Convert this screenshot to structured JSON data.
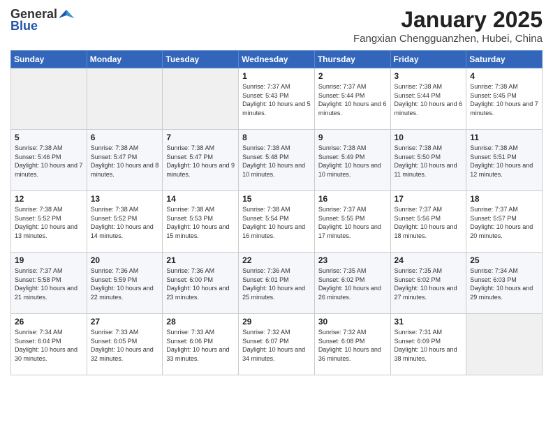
{
  "header": {
    "logo_general": "General",
    "logo_blue": "Blue",
    "title": "January 2025",
    "subtitle": "Fangxian Chengguanzhen, Hubei, China"
  },
  "weekdays": [
    "Sunday",
    "Monday",
    "Tuesday",
    "Wednesday",
    "Thursday",
    "Friday",
    "Saturday"
  ],
  "weeks": [
    [
      {
        "day": "",
        "sunrise": "",
        "sunset": "",
        "daylight": ""
      },
      {
        "day": "",
        "sunrise": "",
        "sunset": "",
        "daylight": ""
      },
      {
        "day": "",
        "sunrise": "",
        "sunset": "",
        "daylight": ""
      },
      {
        "day": "1",
        "sunrise": "Sunrise: 7:37 AM",
        "sunset": "Sunset: 5:43 PM",
        "daylight": "Daylight: 10 hours and 5 minutes."
      },
      {
        "day": "2",
        "sunrise": "Sunrise: 7:37 AM",
        "sunset": "Sunset: 5:44 PM",
        "daylight": "Daylight: 10 hours and 6 minutes."
      },
      {
        "day": "3",
        "sunrise": "Sunrise: 7:38 AM",
        "sunset": "Sunset: 5:44 PM",
        "daylight": "Daylight: 10 hours and 6 minutes."
      },
      {
        "day": "4",
        "sunrise": "Sunrise: 7:38 AM",
        "sunset": "Sunset: 5:45 PM",
        "daylight": "Daylight: 10 hours and 7 minutes."
      }
    ],
    [
      {
        "day": "5",
        "sunrise": "Sunrise: 7:38 AM",
        "sunset": "Sunset: 5:46 PM",
        "daylight": "Daylight: 10 hours and 7 minutes."
      },
      {
        "day": "6",
        "sunrise": "Sunrise: 7:38 AM",
        "sunset": "Sunset: 5:47 PM",
        "daylight": "Daylight: 10 hours and 8 minutes."
      },
      {
        "day": "7",
        "sunrise": "Sunrise: 7:38 AM",
        "sunset": "Sunset: 5:47 PM",
        "daylight": "Daylight: 10 hours and 9 minutes."
      },
      {
        "day": "8",
        "sunrise": "Sunrise: 7:38 AM",
        "sunset": "Sunset: 5:48 PM",
        "daylight": "Daylight: 10 hours and 10 minutes."
      },
      {
        "day": "9",
        "sunrise": "Sunrise: 7:38 AM",
        "sunset": "Sunset: 5:49 PM",
        "daylight": "Daylight: 10 hours and 10 minutes."
      },
      {
        "day": "10",
        "sunrise": "Sunrise: 7:38 AM",
        "sunset": "Sunset: 5:50 PM",
        "daylight": "Daylight: 10 hours and 11 minutes."
      },
      {
        "day": "11",
        "sunrise": "Sunrise: 7:38 AM",
        "sunset": "Sunset: 5:51 PM",
        "daylight": "Daylight: 10 hours and 12 minutes."
      }
    ],
    [
      {
        "day": "12",
        "sunrise": "Sunrise: 7:38 AM",
        "sunset": "Sunset: 5:52 PM",
        "daylight": "Daylight: 10 hours and 13 minutes."
      },
      {
        "day": "13",
        "sunrise": "Sunrise: 7:38 AM",
        "sunset": "Sunset: 5:52 PM",
        "daylight": "Daylight: 10 hours and 14 minutes."
      },
      {
        "day": "14",
        "sunrise": "Sunrise: 7:38 AM",
        "sunset": "Sunset: 5:53 PM",
        "daylight": "Daylight: 10 hours and 15 minutes."
      },
      {
        "day": "15",
        "sunrise": "Sunrise: 7:38 AM",
        "sunset": "Sunset: 5:54 PM",
        "daylight": "Daylight: 10 hours and 16 minutes."
      },
      {
        "day": "16",
        "sunrise": "Sunrise: 7:37 AM",
        "sunset": "Sunset: 5:55 PM",
        "daylight": "Daylight: 10 hours and 17 minutes."
      },
      {
        "day": "17",
        "sunrise": "Sunrise: 7:37 AM",
        "sunset": "Sunset: 5:56 PM",
        "daylight": "Daylight: 10 hours and 18 minutes."
      },
      {
        "day": "18",
        "sunrise": "Sunrise: 7:37 AM",
        "sunset": "Sunset: 5:57 PM",
        "daylight": "Daylight: 10 hours and 20 minutes."
      }
    ],
    [
      {
        "day": "19",
        "sunrise": "Sunrise: 7:37 AM",
        "sunset": "Sunset: 5:58 PM",
        "daylight": "Daylight: 10 hours and 21 minutes."
      },
      {
        "day": "20",
        "sunrise": "Sunrise: 7:36 AM",
        "sunset": "Sunset: 5:59 PM",
        "daylight": "Daylight: 10 hours and 22 minutes."
      },
      {
        "day": "21",
        "sunrise": "Sunrise: 7:36 AM",
        "sunset": "Sunset: 6:00 PM",
        "daylight": "Daylight: 10 hours and 23 minutes."
      },
      {
        "day": "22",
        "sunrise": "Sunrise: 7:36 AM",
        "sunset": "Sunset: 6:01 PM",
        "daylight": "Daylight: 10 hours and 25 minutes."
      },
      {
        "day": "23",
        "sunrise": "Sunrise: 7:35 AM",
        "sunset": "Sunset: 6:02 PM",
        "daylight": "Daylight: 10 hours and 26 minutes."
      },
      {
        "day": "24",
        "sunrise": "Sunrise: 7:35 AM",
        "sunset": "Sunset: 6:02 PM",
        "daylight": "Daylight: 10 hours and 27 minutes."
      },
      {
        "day": "25",
        "sunrise": "Sunrise: 7:34 AM",
        "sunset": "Sunset: 6:03 PM",
        "daylight": "Daylight: 10 hours and 29 minutes."
      }
    ],
    [
      {
        "day": "26",
        "sunrise": "Sunrise: 7:34 AM",
        "sunset": "Sunset: 6:04 PM",
        "daylight": "Daylight: 10 hours and 30 minutes."
      },
      {
        "day": "27",
        "sunrise": "Sunrise: 7:33 AM",
        "sunset": "Sunset: 6:05 PM",
        "daylight": "Daylight: 10 hours and 32 minutes."
      },
      {
        "day": "28",
        "sunrise": "Sunrise: 7:33 AM",
        "sunset": "Sunset: 6:06 PM",
        "daylight": "Daylight: 10 hours and 33 minutes."
      },
      {
        "day": "29",
        "sunrise": "Sunrise: 7:32 AM",
        "sunset": "Sunset: 6:07 PM",
        "daylight": "Daylight: 10 hours and 34 minutes."
      },
      {
        "day": "30",
        "sunrise": "Sunrise: 7:32 AM",
        "sunset": "Sunset: 6:08 PM",
        "daylight": "Daylight: 10 hours and 36 minutes."
      },
      {
        "day": "31",
        "sunrise": "Sunrise: 7:31 AM",
        "sunset": "Sunset: 6:09 PM",
        "daylight": "Daylight: 10 hours and 38 minutes."
      },
      {
        "day": "",
        "sunrise": "",
        "sunset": "",
        "daylight": ""
      }
    ]
  ]
}
